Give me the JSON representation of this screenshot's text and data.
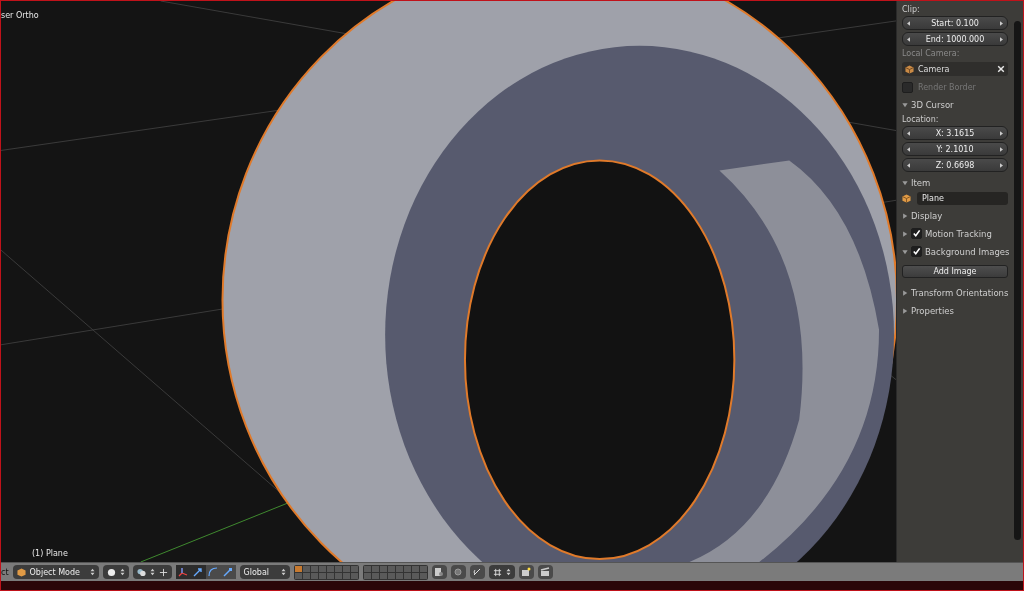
{
  "viewport": {
    "view_name": "ser Ortho",
    "object_label": "(1) Plane"
  },
  "panel": [
    {
      "kind": "label",
      "text": "Clip:"
    },
    {
      "kind": "number",
      "text": "Start: 0.100"
    },
    {
      "kind": "number",
      "text": "End: 1000.000"
    },
    {
      "kind": "dim_label",
      "text": "Local Camera:"
    },
    {
      "kind": "object",
      "text": "Camera"
    },
    {
      "kind": "checkbox",
      "text": "Render Border",
      "checked": false
    },
    {
      "kind": "section",
      "text": "3D Cursor",
      "expanded": true
    },
    {
      "kind": "label",
      "text": "Location:"
    },
    {
      "kind": "number",
      "text": "X: 3.1615"
    },
    {
      "kind": "number",
      "text": "Y: 2.1010"
    },
    {
      "kind": "number",
      "text": "Z: 0.6698"
    },
    {
      "kind": "section",
      "text": "Item",
      "expanded": true
    },
    {
      "kind": "name",
      "text": "Plane"
    },
    {
      "kind": "section",
      "text": "Display",
      "expanded": false
    },
    {
      "kind": "section",
      "text": "Motion Tracking",
      "expanded": false,
      "checked": true
    },
    {
      "kind": "section",
      "text": "Background Images",
      "expanded": true,
      "checked": true
    },
    {
      "kind": "button",
      "text": "Add Image"
    },
    {
      "kind": "section",
      "text": "Transform Orientations",
      "expanded": false
    },
    {
      "kind": "section",
      "text": "Properties",
      "expanded": false
    }
  ],
  "header": {
    "menu_fragment": "ct",
    "mode": "Object Mode",
    "orientation": "Global"
  }
}
